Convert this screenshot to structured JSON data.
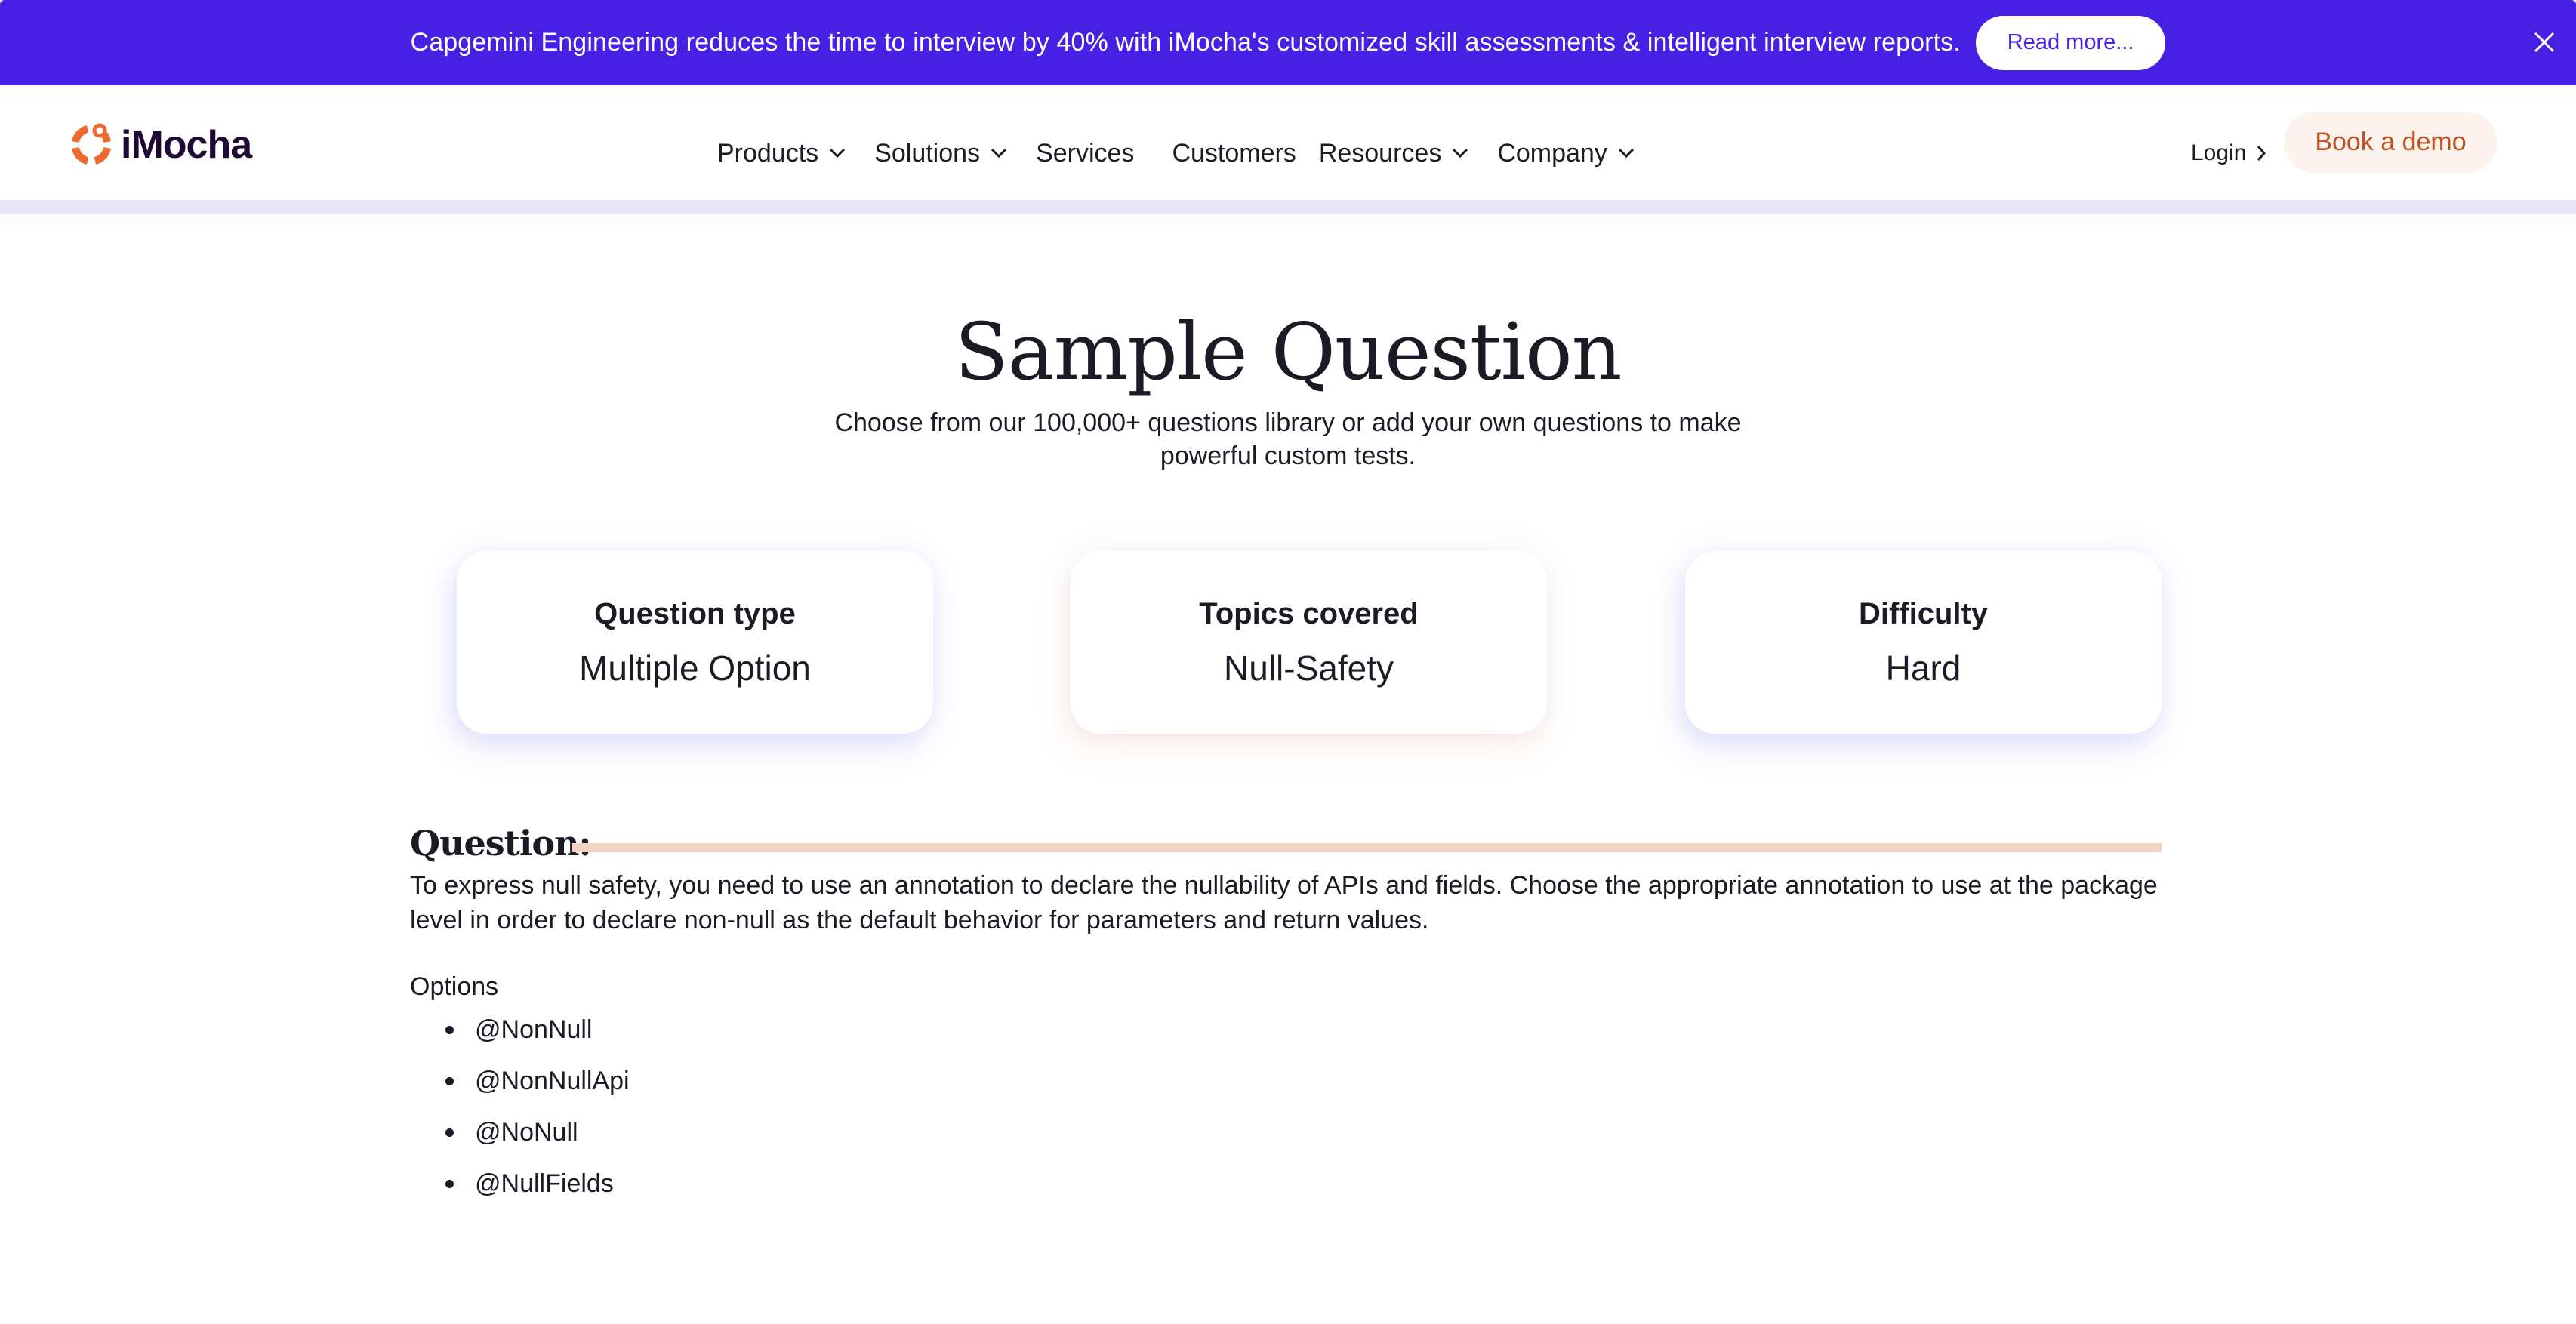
{
  "banner": {
    "text": "Capgemini Engineering reduces the time to interview by 40% with iMocha's customized skill assessments & intelligent interview reports.",
    "button_label": "Read more...",
    "close_icon": "close-icon",
    "background_color": "#4620e3"
  },
  "nav": {
    "logo_text": "iMocha",
    "logo_icon": "imocha-logo-icon",
    "items": [
      {
        "label": "Products",
        "has_dropdown": true
      },
      {
        "label": "Solutions",
        "has_dropdown": true
      },
      {
        "label": "Services",
        "has_dropdown": false
      },
      {
        "label": "Customers",
        "has_dropdown": false
      },
      {
        "label": "Resources",
        "has_dropdown": true
      },
      {
        "label": "Company",
        "has_dropdown": true
      }
    ],
    "login_label": "Login",
    "demo_label": "Book a demo",
    "accent_color": "#c0501f"
  },
  "header": {
    "title": "Sample Question",
    "subtitle": "Choose from our 100,000+ questions library or add your own questions to make powerful custom tests."
  },
  "cards": [
    {
      "label": "Question type",
      "value": "Multiple Option"
    },
    {
      "label": "Topics covered",
      "value": "Null-Safety"
    },
    {
      "label": "Difficulty",
      "value": "Hard"
    }
  ],
  "question": {
    "heading": "Question:",
    "text": "To express null safety, you need to use an annotation to declare the nullability of APIs and fields. Choose the appropriate annotation to use at the package level in order to declare non-null as the default behavior for parameters and return values.",
    "options_label": "Options",
    "options": [
      "@NonNull",
      "@NonNullApi",
      "@NoNull",
      "@NullFields"
    ]
  }
}
